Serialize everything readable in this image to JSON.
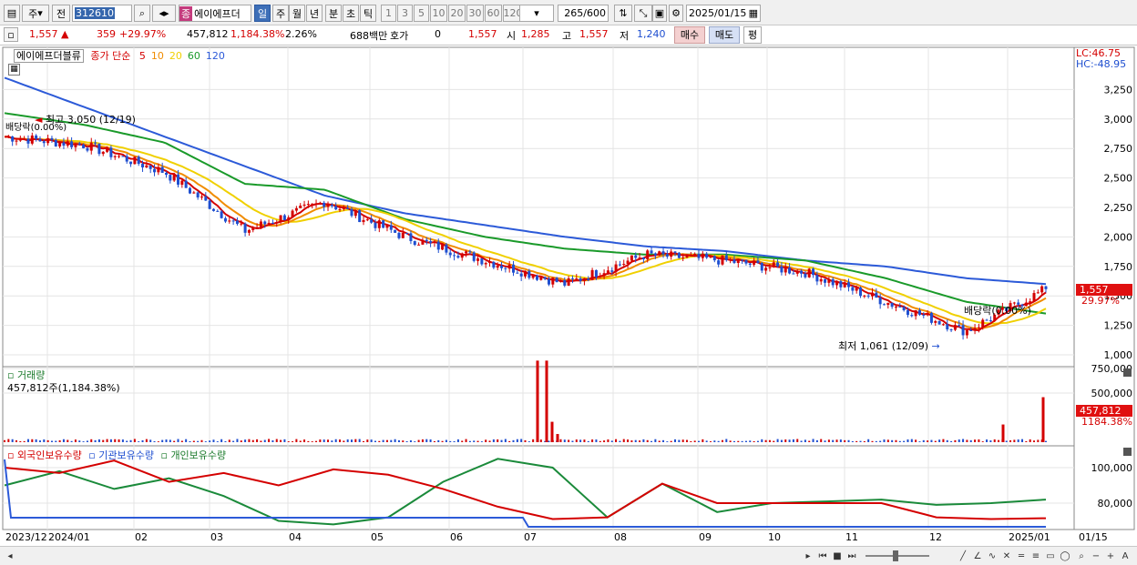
{
  "toolbar": {
    "tab_day": "주",
    "tab_all": "전",
    "stock_code": "312610",
    "stock_name_badge": "종",
    "stock_name": "에이에프더",
    "periods": [
      "일",
      "주",
      "월",
      "년",
      "분",
      "초",
      "틱"
    ],
    "minute_options": [
      "1",
      "3",
      "5",
      "10",
      "20",
      "30",
      "60",
      "120"
    ],
    "count": "265",
    "count_total": "/600",
    "date": "2025/01/15"
  },
  "info": {
    "price": "1,557",
    "change": "359",
    "change_pct": "+29.97%",
    "volume": "457,812",
    "volume_pct": "1,184.38%",
    "turnover": "2.26%",
    "amount": "688백만",
    "quote_label": "호가",
    "quote_value": "0",
    "quote_price": "1,557",
    "open_label": "시",
    "open": "1,285",
    "high_label": "고",
    "high": "1,557",
    "low_label": "저",
    "low": "1,240",
    "buy": "매수",
    "sell": "매도",
    "eval": "평"
  },
  "price_panel": {
    "name_tag": "에이에프더블류",
    "ma_label": "종가 단순",
    "ma_periods": [
      "5",
      "10",
      "20",
      "60",
      "120"
    ],
    "ma_colors": [
      "#d40000",
      "#f08c00",
      "#f0d000",
      "#1a9a2a",
      "#2c5ad8"
    ],
    "lc": "LC:46.75",
    "hc": "HC:-48.95",
    "y_ticks": [
      "3,250",
      "3,000",
      "2,750",
      "2,500",
      "2,250",
      "2,000",
      "1,750",
      "1,500",
      "1,250",
      "1,000"
    ],
    "current_price_tag": "1,557",
    "current_pct_tag": "29.97%",
    "high_note": "최고 3,050 (12/19)",
    "low_note": "최저 1,061 (12/09)",
    "dividend_note_left": "배당락(0.00%)",
    "dividend_note_right": "배당락(0.00%)"
  },
  "volume_panel": {
    "title": "거래량",
    "value": "457,812주(1,184.38%)",
    "y_ticks": [
      "750,000",
      "500,000"
    ],
    "tag_value": "457,812",
    "tag_pct": "1184.38%"
  },
  "holding_panel": {
    "foreign": "외국인보유수량",
    "institution": "기관보유수량",
    "individual": "개인보유수량",
    "y_ticks": [
      "100,000",
      "80,000"
    ]
  },
  "x_axis": [
    "2023/12",
    "2024/01",
    "02",
    "03",
    "04",
    "05",
    "06",
    "07",
    "08",
    "09",
    "10",
    "11",
    "12",
    "2025/01",
    "01/15"
  ],
  "chart_data": {
    "type": "line",
    "x_labels": [
      "2023/12",
      "2024/01",
      "02",
      "03",
      "04",
      "05",
      "06",
      "07",
      "08",
      "09",
      "10",
      "11",
      "12",
      "2025/01"
    ],
    "price_ylim": [
      1000,
      3250
    ],
    "close_approx": [
      2850,
      2780,
      2550,
      2050,
      2300,
      2000,
      1800,
      1600,
      1850,
      1800,
      1700,
      1450,
      1200,
      1557
    ],
    "ma120_approx": [
      3350,
      3100,
      2850,
      2600,
      2350,
      2200,
      2100,
      2000,
      1920,
      1880,
      1800,
      1750,
      1650,
      1600
    ],
    "ma60_approx": [
      3050,
      2950,
      2800,
      2450,
      2400,
      2150,
      2000,
      1900,
      1850,
      1850,
      1800,
      1650,
      1450,
      1350
    ],
    "volume_spikes": [
      {
        "x": "07",
        "value": 830000
      },
      {
        "x": "12",
        "value": 180000
      },
      {
        "x": "01/15",
        "value": 457812
      }
    ]
  }
}
